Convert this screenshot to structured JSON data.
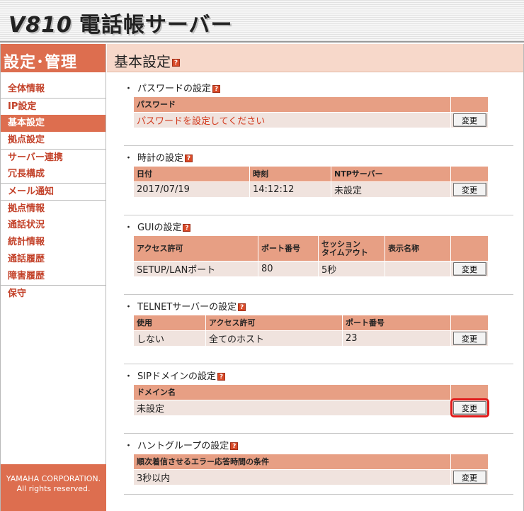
{
  "header": {
    "model": "V810",
    "title": "電話帳サーバー"
  },
  "sidebar": {
    "heading": "設定･管理",
    "items": [
      {
        "label": "全体情報"
      },
      {
        "label": "IP設定"
      },
      {
        "label": "基本設定",
        "active": true
      },
      {
        "label": "拠点設定"
      },
      {
        "label": "サーバー連携"
      },
      {
        "label": "冗長構成"
      },
      {
        "label": "メール通知"
      },
      {
        "label": "拠点情報"
      },
      {
        "label": "通話状況"
      },
      {
        "label": "統計情報"
      },
      {
        "label": "通話履歴"
      },
      {
        "label": "障害履歴"
      },
      {
        "label": "保守"
      }
    ],
    "footer_line1": "YAMAHA CORPORATION.",
    "footer_line2": "All rights reserved."
  },
  "main": {
    "title": "基本設定"
  },
  "help_glyph": "?",
  "button_label": "変更",
  "sections": {
    "password": {
      "title": "パスワードの設定",
      "header": "パスワード",
      "value": "パスワードを設定してください"
    },
    "clock": {
      "title": "時計の設定",
      "headers": [
        "日付",
        "時刻",
        "NTPサーバー"
      ],
      "values": [
        "2017/07/19",
        "14:12:12",
        "未設定"
      ]
    },
    "gui": {
      "title": "GUIの設定",
      "headers": [
        "アクセス許可",
        "ポート番号",
        "セッション\nタイムアウト",
        "表示名称"
      ],
      "values": [
        "SETUP/LANポート",
        "80",
        "5秒",
        ""
      ]
    },
    "telnet": {
      "title": "TELNETサーバーの設定",
      "headers": [
        "使用",
        "アクセス許可",
        "ポート番号"
      ],
      "values": [
        "しない",
        "全てのホスト",
        "23"
      ]
    },
    "sip": {
      "title": "SIPドメインの設定",
      "header": "ドメイン名",
      "value": "未設定"
    },
    "hunt": {
      "title": "ハントグループの設定",
      "header": "順次着信させるエラー応答時間の条件",
      "value": "3秒以内"
    }
  },
  "colors": {
    "accent": "#dd6e4f",
    "table_header": "#e79f84",
    "table_cell": "#f0e3de",
    "highlight": "#e01a1a"
  }
}
